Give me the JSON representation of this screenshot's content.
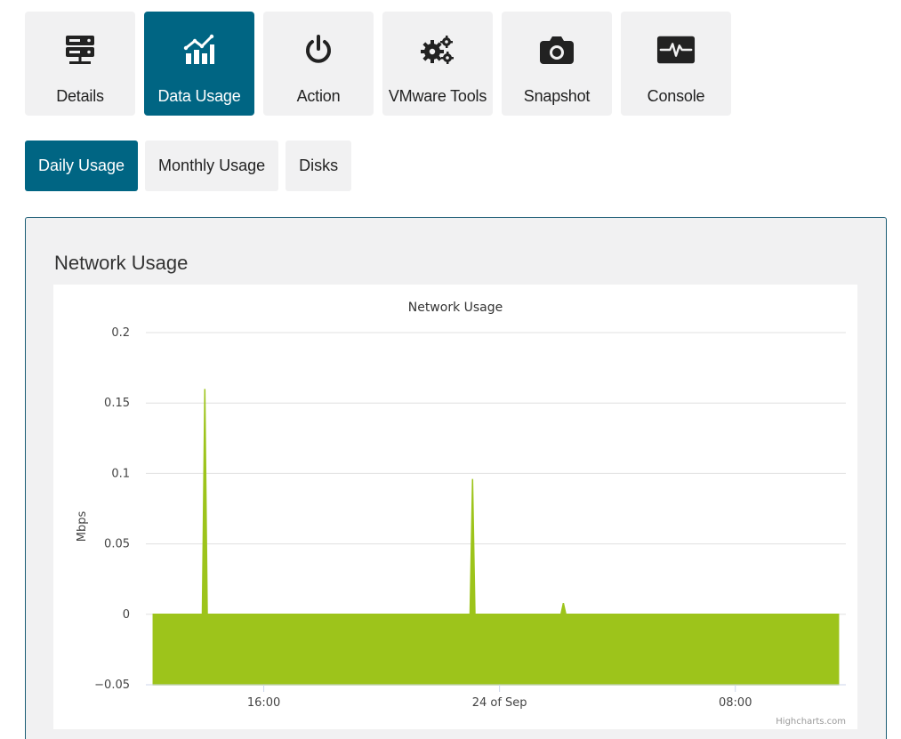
{
  "top_tabs": [
    {
      "label": "Details",
      "icon": "server-icon",
      "active": false
    },
    {
      "label": "Data Usage",
      "icon": "bar-chart-icon",
      "active": true
    },
    {
      "label": "Action",
      "icon": "power-icon",
      "active": false
    },
    {
      "label": "VMware Tools",
      "icon": "gears-icon",
      "active": false
    },
    {
      "label": "Snapshot",
      "icon": "camera-icon",
      "active": false
    },
    {
      "label": "Console",
      "icon": "pulse-monitor-icon",
      "active": false
    }
  ],
  "sub_tabs": [
    {
      "label": "Daily Usage",
      "active": true
    },
    {
      "label": "Monthly Usage",
      "active": false
    },
    {
      "label": "Disks",
      "active": false
    }
  ],
  "panel": {
    "title": "Network Usage"
  },
  "colors": {
    "accent": "#006583",
    "series": "#9dc41b",
    "tab_bg": "#f1f1f2"
  },
  "chart_data": {
    "type": "area",
    "title": "Network Usage",
    "ylabel": "Mbps",
    "xlabel": "",
    "ylim": [
      -0.05,
      0.2
    ],
    "yticks": [
      {
        "value": 0.2,
        "label": "0.2"
      },
      {
        "value": 0.15,
        "label": "0.15"
      },
      {
        "value": 0.1,
        "label": "0.1"
      },
      {
        "value": 0.05,
        "label": "0.05"
      },
      {
        "value": 0,
        "label": "0"
      },
      {
        "value": -0.05,
        "label": "−0.05"
      }
    ],
    "xrange": [
      "2023-09-23 12:00",
      "2023-09-24 11:45"
    ],
    "xticks": [
      {
        "x": "2023-09-23 16:00",
        "label": "16:00"
      },
      {
        "x": "2023-09-24 00:00",
        "label": "24 of Sep"
      },
      {
        "x": "2023-09-24 08:00",
        "label": "08:00"
      }
    ],
    "grid": true,
    "legend": "none",
    "credits": "Highcharts.com",
    "series": [
      {
        "points": [
          [
            "2023-09-23 12:15",
            0
          ],
          [
            "2023-09-23 13:55",
            0
          ],
          [
            "2023-09-23 14:00",
            0.16
          ],
          [
            "2023-09-23 14:05",
            0
          ],
          [
            "2023-09-23 23:00",
            0
          ],
          [
            "2023-09-23 23:05",
            0.096
          ],
          [
            "2023-09-23 23:10",
            0
          ],
          [
            "2023-09-24 02:05",
            0
          ],
          [
            "2023-09-24 02:10",
            0.008
          ],
          [
            "2023-09-24 02:15",
            0
          ],
          [
            "2023-09-24 11:30",
            0
          ]
        ]
      }
    ]
  }
}
